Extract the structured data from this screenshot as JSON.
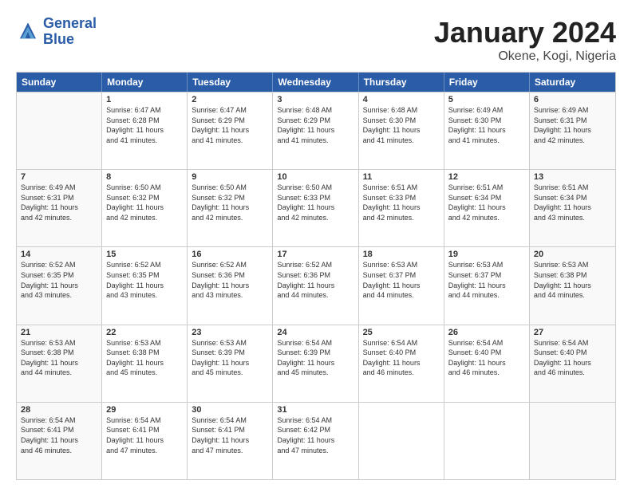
{
  "header": {
    "logo_line1": "General",
    "logo_line2": "Blue",
    "month_title": "January 2024",
    "location": "Okene, Kogi, Nigeria"
  },
  "weekdays": [
    "Sunday",
    "Monday",
    "Tuesday",
    "Wednesday",
    "Thursday",
    "Friday",
    "Saturday"
  ],
  "rows": [
    [
      {
        "num": "",
        "info": ""
      },
      {
        "num": "1",
        "info": "Sunrise: 6:47 AM\nSunset: 6:28 PM\nDaylight: 11 hours\nand 41 minutes."
      },
      {
        "num": "2",
        "info": "Sunrise: 6:47 AM\nSunset: 6:29 PM\nDaylight: 11 hours\nand 41 minutes."
      },
      {
        "num": "3",
        "info": "Sunrise: 6:48 AM\nSunset: 6:29 PM\nDaylight: 11 hours\nand 41 minutes."
      },
      {
        "num": "4",
        "info": "Sunrise: 6:48 AM\nSunset: 6:30 PM\nDaylight: 11 hours\nand 41 minutes."
      },
      {
        "num": "5",
        "info": "Sunrise: 6:49 AM\nSunset: 6:30 PM\nDaylight: 11 hours\nand 41 minutes."
      },
      {
        "num": "6",
        "info": "Sunrise: 6:49 AM\nSunset: 6:31 PM\nDaylight: 11 hours\nand 42 minutes."
      }
    ],
    [
      {
        "num": "7",
        "info": "Sunrise: 6:49 AM\nSunset: 6:31 PM\nDaylight: 11 hours\nand 42 minutes."
      },
      {
        "num": "8",
        "info": "Sunrise: 6:50 AM\nSunset: 6:32 PM\nDaylight: 11 hours\nand 42 minutes."
      },
      {
        "num": "9",
        "info": "Sunrise: 6:50 AM\nSunset: 6:32 PM\nDaylight: 11 hours\nand 42 minutes."
      },
      {
        "num": "10",
        "info": "Sunrise: 6:50 AM\nSunset: 6:33 PM\nDaylight: 11 hours\nand 42 minutes."
      },
      {
        "num": "11",
        "info": "Sunrise: 6:51 AM\nSunset: 6:33 PM\nDaylight: 11 hours\nand 42 minutes."
      },
      {
        "num": "12",
        "info": "Sunrise: 6:51 AM\nSunset: 6:34 PM\nDaylight: 11 hours\nand 42 minutes."
      },
      {
        "num": "13",
        "info": "Sunrise: 6:51 AM\nSunset: 6:34 PM\nDaylight: 11 hours\nand 43 minutes."
      }
    ],
    [
      {
        "num": "14",
        "info": "Sunrise: 6:52 AM\nSunset: 6:35 PM\nDaylight: 11 hours\nand 43 minutes."
      },
      {
        "num": "15",
        "info": "Sunrise: 6:52 AM\nSunset: 6:35 PM\nDaylight: 11 hours\nand 43 minutes."
      },
      {
        "num": "16",
        "info": "Sunrise: 6:52 AM\nSunset: 6:36 PM\nDaylight: 11 hours\nand 43 minutes."
      },
      {
        "num": "17",
        "info": "Sunrise: 6:52 AM\nSunset: 6:36 PM\nDaylight: 11 hours\nand 44 minutes."
      },
      {
        "num": "18",
        "info": "Sunrise: 6:53 AM\nSunset: 6:37 PM\nDaylight: 11 hours\nand 44 minutes."
      },
      {
        "num": "19",
        "info": "Sunrise: 6:53 AM\nSunset: 6:37 PM\nDaylight: 11 hours\nand 44 minutes."
      },
      {
        "num": "20",
        "info": "Sunrise: 6:53 AM\nSunset: 6:38 PM\nDaylight: 11 hours\nand 44 minutes."
      }
    ],
    [
      {
        "num": "21",
        "info": "Sunrise: 6:53 AM\nSunset: 6:38 PM\nDaylight: 11 hours\nand 44 minutes."
      },
      {
        "num": "22",
        "info": "Sunrise: 6:53 AM\nSunset: 6:38 PM\nDaylight: 11 hours\nand 45 minutes."
      },
      {
        "num": "23",
        "info": "Sunrise: 6:53 AM\nSunset: 6:39 PM\nDaylight: 11 hours\nand 45 minutes."
      },
      {
        "num": "24",
        "info": "Sunrise: 6:54 AM\nSunset: 6:39 PM\nDaylight: 11 hours\nand 45 minutes."
      },
      {
        "num": "25",
        "info": "Sunrise: 6:54 AM\nSunset: 6:40 PM\nDaylight: 11 hours\nand 46 minutes."
      },
      {
        "num": "26",
        "info": "Sunrise: 6:54 AM\nSunset: 6:40 PM\nDaylight: 11 hours\nand 46 minutes."
      },
      {
        "num": "27",
        "info": "Sunrise: 6:54 AM\nSunset: 6:40 PM\nDaylight: 11 hours\nand 46 minutes."
      }
    ],
    [
      {
        "num": "28",
        "info": "Sunrise: 6:54 AM\nSunset: 6:41 PM\nDaylight: 11 hours\nand 46 minutes."
      },
      {
        "num": "29",
        "info": "Sunrise: 6:54 AM\nSunset: 6:41 PM\nDaylight: 11 hours\nand 47 minutes."
      },
      {
        "num": "30",
        "info": "Sunrise: 6:54 AM\nSunset: 6:41 PM\nDaylight: 11 hours\nand 47 minutes."
      },
      {
        "num": "31",
        "info": "Sunrise: 6:54 AM\nSunset: 6:42 PM\nDaylight: 11 hours\nand 47 minutes."
      },
      {
        "num": "",
        "info": ""
      },
      {
        "num": "",
        "info": ""
      },
      {
        "num": "",
        "info": ""
      }
    ]
  ]
}
